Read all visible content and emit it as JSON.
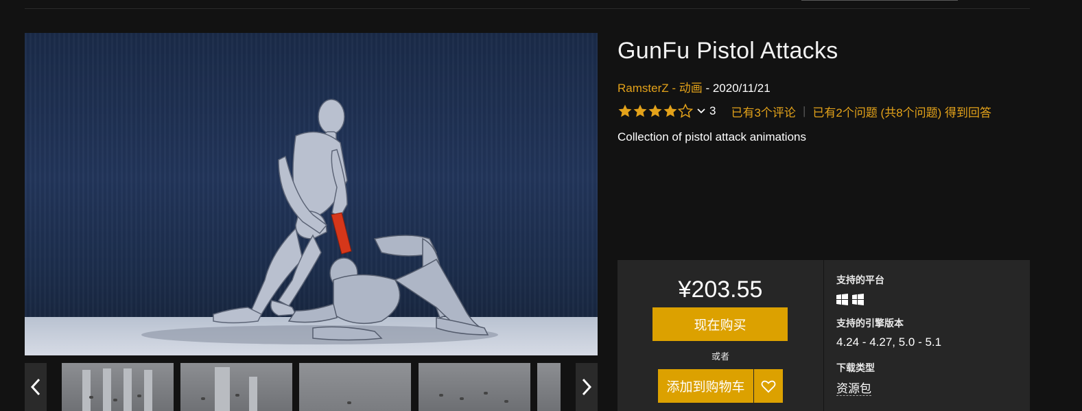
{
  "product": {
    "title": "GunFu Pistol Attacks",
    "seller": "RamsterZ",
    "meta_sep1": " - ",
    "category": "动画",
    "meta_sep2": " - ",
    "date": "2020/11/21",
    "rating_stars": 4,
    "rating_max": 5,
    "rating_count": "3",
    "reviews_link": "已有3个评论",
    "questions_link": "已有2个问题 (共8个问题) 得到回答",
    "description": "Collection of pistol attack animations"
  },
  "purchase": {
    "price": "¥203.55",
    "buy_now_label": "现在购买",
    "or_label": "或者",
    "add_to_cart_label": "添加到购物车"
  },
  "specs": {
    "platforms_label": "支持的平台",
    "platform_icons": [
      "windows-icon",
      "windows-icon"
    ],
    "engine_label": "支持的引擎版本",
    "engine_versions": "4.24 - 4.27, 5.0 - 5.1",
    "download_label": "下载类型",
    "download_type": "资源包"
  },
  "gallery": {
    "thumbnail_count": 5
  },
  "colors": {
    "accent": "#dca100",
    "link": "#e3a21a",
    "background": "#121212",
    "panel": "#262626"
  }
}
